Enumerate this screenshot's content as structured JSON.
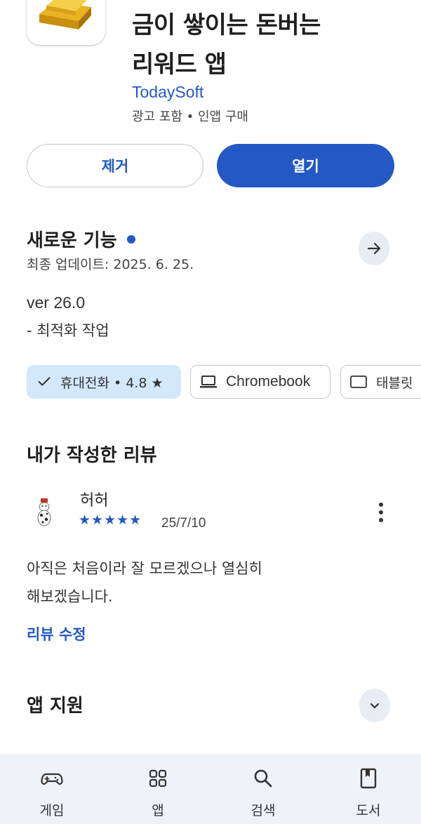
{
  "app": {
    "title_line1": "금이 쌓이는 돈버는",
    "title_line2": "리워드 앱",
    "developer": "TodaySoft",
    "meta": "광고 포함 • 인앱 구매",
    "icon": "gold-bars-icon"
  },
  "actions": {
    "uninstall_label": "제거",
    "open_label": "열기"
  },
  "whats_new": {
    "title": "새로운 기능",
    "last_updated": "최종 업데이트: 2025. 6. 25.",
    "version": "ver 26.0",
    "notes": "- 최적화 작업"
  },
  "devices": [
    {
      "label": "휴대전화 • 4.8 ★",
      "selected": true,
      "icon": "check-icon"
    },
    {
      "label": "Chromebook",
      "selected": false,
      "icon": "laptop-icon"
    },
    {
      "label": "태블릿",
      "selected": false,
      "icon": "tablet-icon"
    }
  ],
  "my_review": {
    "heading": "내가 작성한 리뷰",
    "reviewer": "허허",
    "rating": 5,
    "stars": "★★★★★",
    "date": "25/7/10",
    "body_line1": "아직은 처음이라 잘 모르겠으나 열심히",
    "body_line2": "해보겠습니다.",
    "edit_label": "리뷰 수정"
  },
  "app_support": {
    "title": "앱 지원"
  },
  "bottom_nav": [
    {
      "label": "게임",
      "icon": "gamepad-icon"
    },
    {
      "label": "앱",
      "icon": "apps-grid-icon"
    },
    {
      "label": "검색",
      "icon": "search-icon"
    },
    {
      "label": "도서",
      "icon": "book-icon"
    }
  ],
  "colors": {
    "accent": "#2458c4",
    "chip_selected_bg": "#d3e8fb",
    "nav_bg": "#eef2f9"
  }
}
